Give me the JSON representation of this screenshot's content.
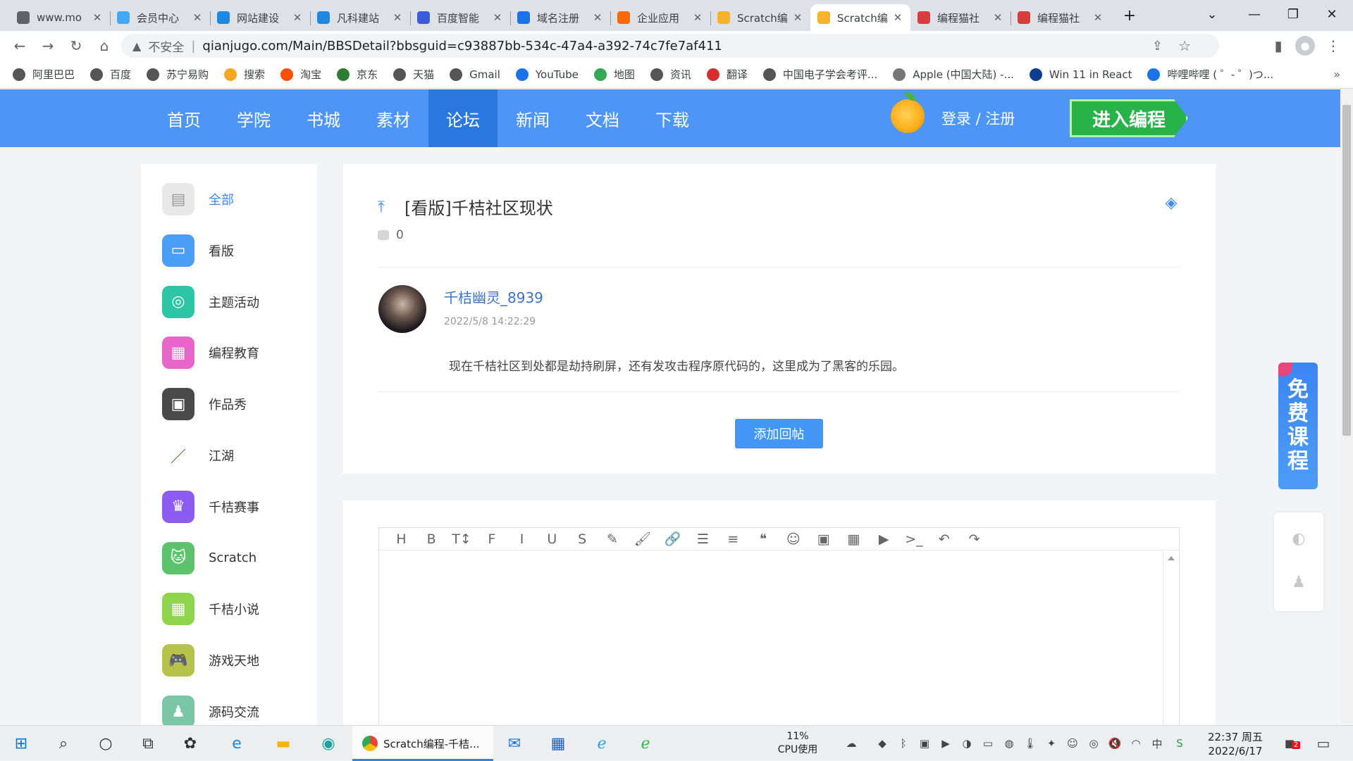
{
  "browser": {
    "tabs": [
      {
        "title": "www.mo",
        "color": "#5f6368",
        "icon": "globe-icon"
      },
      {
        "title": "会员中心",
        "color": "#3fa9f5",
        "icon": "site-icon"
      },
      {
        "title": "网站建设",
        "color": "#1e88e5",
        "icon": "site-icon"
      },
      {
        "title": "凡科建站",
        "color": "#1e88e5",
        "icon": "site-icon"
      },
      {
        "title": "百度智能",
        "color": "#3b5bdb",
        "icon": "cube-icon"
      },
      {
        "title": "域名注册",
        "color": "#1a73e8",
        "icon": "cloud-icon"
      },
      {
        "title": "企业应用",
        "color": "#ff6a00",
        "icon": "bracket-icon"
      },
      {
        "title": "Scratch编",
        "color": "#f7b32b",
        "icon": "orange-icon"
      },
      {
        "title": "Scratch编",
        "color": "#f7b32b",
        "icon": "orange-icon",
        "active": true
      },
      {
        "title": "编程猫社",
        "color": "#d83c3c",
        "icon": "cat-icon"
      },
      {
        "title": "编程猫社",
        "color": "#d83c3c",
        "icon": "cat-icon"
      }
    ],
    "new_tab": "+",
    "insecure_label": "不安全",
    "url": "qianjugo.com/Main/BBSDetail?bbsguid=c93887bb-534c-47a4-a392-74c7fe7af411",
    "bookmarks": [
      {
        "label": "阿里巴巴",
        "color": "#555"
      },
      {
        "label": "百度",
        "color": "#555"
      },
      {
        "label": "苏宁易购",
        "color": "#555"
      },
      {
        "label": "搜索",
        "color": "#f5a623"
      },
      {
        "label": "淘宝",
        "color": "#ff5000"
      },
      {
        "label": "京东",
        "color": "#2e7d32"
      },
      {
        "label": "天猫",
        "color": "#555"
      },
      {
        "label": "Gmail",
        "color": "#555"
      },
      {
        "label": "YouTube",
        "color": "#1a73e8"
      },
      {
        "label": "地图",
        "color": "#34a853"
      },
      {
        "label": "资讯",
        "color": "#555"
      },
      {
        "label": "翻译",
        "color": "#d32f2f"
      },
      {
        "label": "中国电子学会考评...",
        "color": "#555"
      },
      {
        "label": "Apple (中国大陆) -...",
        "color": "#777"
      },
      {
        "label": "Win 11 in React",
        "color": "#0b3d91"
      },
      {
        "label": "哔哩哔哩 ( ゜- ゜)つ...",
        "color": "#1a73e8"
      }
    ],
    "more_bookmarks": "»"
  },
  "site": {
    "nav": [
      "首页",
      "学院",
      "书城",
      "素材",
      "论坛",
      "新闻",
      "文档",
      "下载"
    ],
    "active_nav": 4,
    "login": "登录 / 注册",
    "enter_button": "进入编程",
    "sidebar": [
      {
        "label": "全部",
        "color": "#e8e8e8",
        "icon": "browser-window-icon"
      },
      {
        "label": "看版",
        "color": "#4a9ff5",
        "icon": "billboard-icon"
      },
      {
        "label": "主题活动",
        "color": "#2ec4a6",
        "icon": "target-icon"
      },
      {
        "label": "编程教育",
        "color": "#e667c9",
        "icon": "classroom-icon"
      },
      {
        "label": "作品秀",
        "color": "#4a4a4a",
        "icon": "box-icon"
      },
      {
        "label": "江湖",
        "color": "#ffffff",
        "icon": "sword-icon"
      },
      {
        "label": "千桔赛事",
        "color": "#8c5cf0",
        "icon": "trophy-icon"
      },
      {
        "label": "Scratch",
        "color": "#5cc26b",
        "icon": "scratch-cat-icon"
      },
      {
        "label": "千桔小说",
        "color": "#8fd44c",
        "icon": "book-icon"
      },
      {
        "label": "游戏天地",
        "color": "#b5c34a",
        "icon": "gamepad-icon"
      },
      {
        "label": "源码交流",
        "color": "#7ac6a5",
        "icon": "people-icon"
      }
    ],
    "active_sidebar": 0
  },
  "post": {
    "title": "[看版]千桔社区现状",
    "comment_count": "0",
    "author": "千桔幽灵_8939",
    "date": "2022/5/8 14:22:29",
    "content": "现在千桔社区到处都是劫持刷屏，还有发攻击程序原代码的，这里成为了黑客的乐园。",
    "reply_button": "添加回帖"
  },
  "editor": {
    "toolbar": [
      "H",
      "B",
      "T↕",
      "F",
      "I",
      "U",
      "S",
      "✎",
      "🖌",
      "🔗",
      "☰",
      "≡",
      "❝",
      "☺",
      "▣",
      "▦",
      "▶",
      ">_",
      "↶",
      "↷"
    ],
    "toolbar_names": [
      "heading",
      "bold",
      "font-size",
      "font",
      "italic",
      "underline",
      "strikethrough",
      "highlight",
      "brush",
      "link",
      "bullet-list",
      "align",
      "quote",
      "emoji",
      "image",
      "table",
      "video",
      "code",
      "undo",
      "redo"
    ]
  },
  "floating": {
    "free_course": [
      "免",
      "费",
      "课",
      "程"
    ]
  },
  "taskbar": {
    "chrome_title": "Scratch编程-千桔...",
    "cpu_percent": "11%",
    "cpu_label": "CPU使用",
    "time": "22:37 周五",
    "date": "2022/6/17",
    "notification_count": "2"
  }
}
